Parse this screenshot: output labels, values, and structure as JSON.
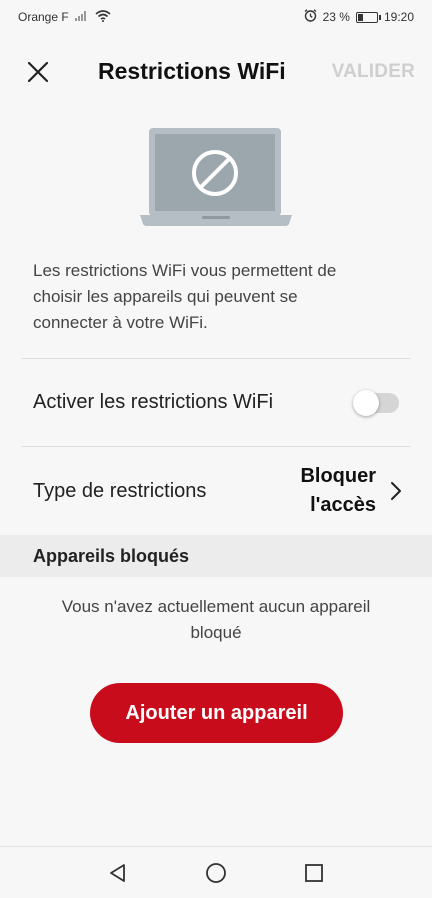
{
  "status_bar": {
    "carrier": "Orange F",
    "battery_percent": "23 %",
    "battery_level": 0.23,
    "time": "19:20"
  },
  "header": {
    "title": "Restrictions WiFi",
    "validate_label": "VALIDER"
  },
  "description": "Les restrictions WiFi vous permettent de choisir les appareils qui peuvent se connecter à votre WiFi.",
  "toggle_row": {
    "label": "Activer les restrictions WiFi",
    "enabled": false
  },
  "type_row": {
    "label": "Type de restrictions",
    "value_line1": "Bloquer",
    "value_line2": "l'accès"
  },
  "blocked_section": {
    "title": "Appareils bloqués",
    "empty_text": "Vous n'avez actuellement aucun appareil bloqué"
  },
  "add_button": {
    "label": "Ajouter un appareil"
  },
  "colors": {
    "accent": "#c80c1b",
    "disabled_text": "#cfcfcf"
  }
}
